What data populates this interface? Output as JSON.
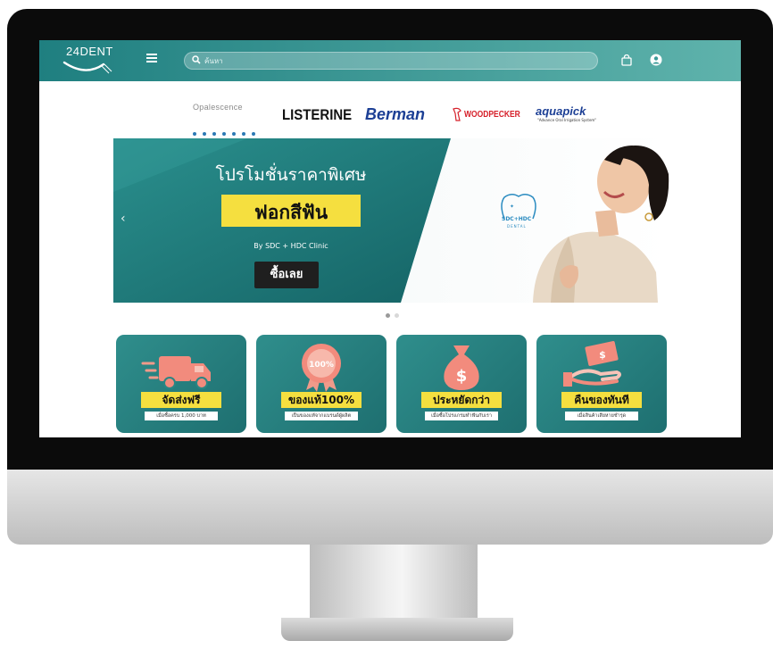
{
  "header": {
    "logo_text": "24DENT",
    "search_placeholder": "ค้นหา"
  },
  "brands": [
    {
      "name": "Opalescence"
    },
    {
      "name": "LISTERINE"
    },
    {
      "name": "Berman"
    },
    {
      "name": "WOODPECKER"
    },
    {
      "name": "aquapick",
      "tagline": "\"Advance Oral Irrigation System\""
    }
  ],
  "banner": {
    "title": "โปรโมชั่นราคาพิเศษ",
    "highlight": "ฟอกสีฟัน",
    "subtitle": "By SDC + HDC Clinic",
    "cta": "ซื้อเลย",
    "clinic_logo": "SDC+HDC",
    "clinic_logo_sub": "DENTAL",
    "slide_count": 2,
    "active_slide": 1
  },
  "features": [
    {
      "title": "จัดส่งฟรี",
      "subtitle": "เมื่อซื้อครบ 1,000 บาท",
      "icon": "truck-icon"
    },
    {
      "title": "ของแท้100%",
      "subtitle": "เป็นของแท้จากแบรนด์ผู้ผลิต",
      "icon": "badge-100-icon",
      "badge_text": "100%"
    },
    {
      "title": "ประหยัดกว่า",
      "subtitle": "เมื่อซื้อโปรแกรมทำฟันกับเรา",
      "icon": "money-bag-icon"
    },
    {
      "title": "คืนของทันที",
      "subtitle": "เมื่อสินค้าเสียหายชำรุด",
      "icon": "money-refund-icon"
    }
  ],
  "colors": {
    "nav_start": "#1f7f80",
    "nav_end": "#5fb3ac",
    "teal": "#1e7777",
    "yellow": "#f5df3f"
  }
}
